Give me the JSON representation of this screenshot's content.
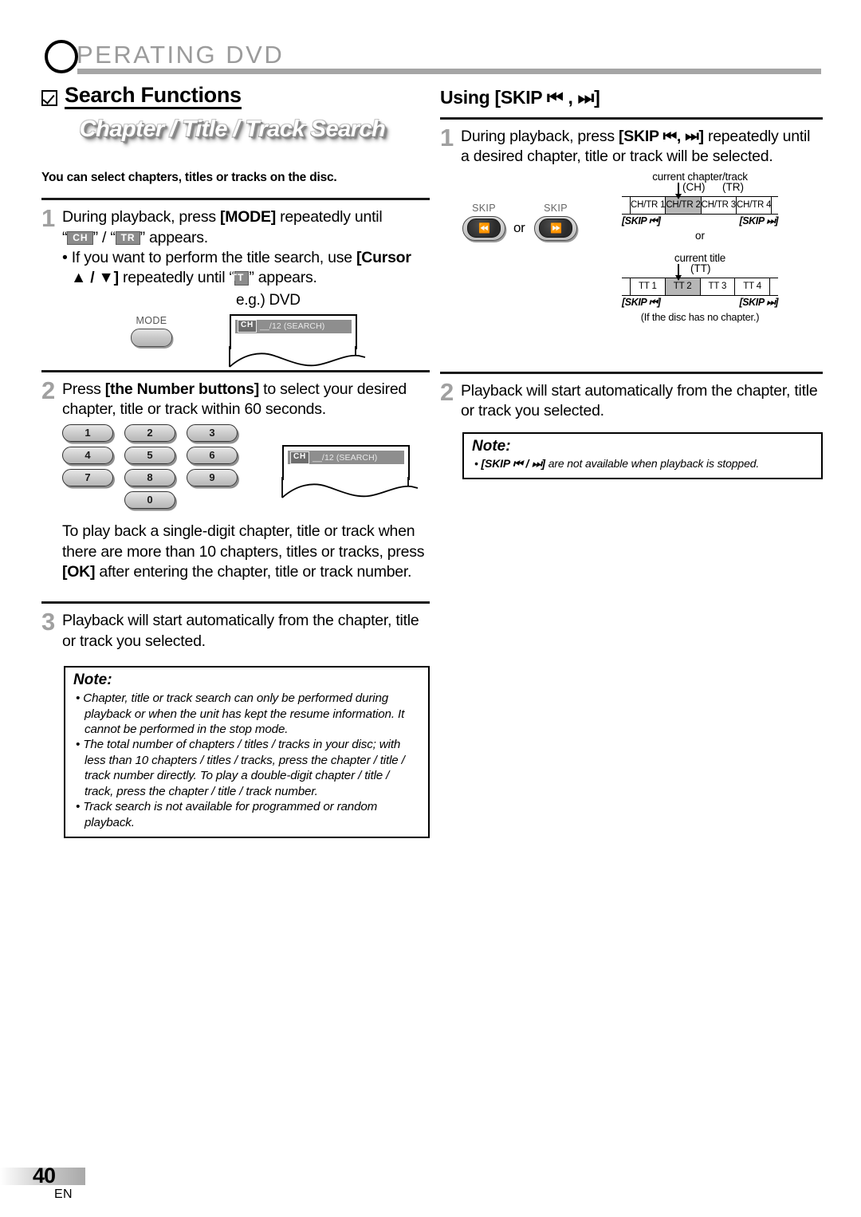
{
  "header": {
    "drop_cap": "O",
    "title": "PERATING  DVD",
    "rule_color": "#a5a5a5"
  },
  "left": {
    "section": {
      "checkbox_icon": "checked-box-icon",
      "title": "Search Functions",
      "banner": "Chapter / Title / Track Search"
    },
    "lead": "You can select chapters, titles or tracks on the disc.",
    "step1": {
      "num": "1",
      "line1_a": "During playback, press ",
      "line1_b": "[MODE]",
      "line1_c": " repeatedly until",
      "line2_open": "“",
      "chip_ch": "CH",
      "line2_mid": "” / “",
      "chip_tr": "TR",
      "line2_end": "” appears.",
      "bullet_a": "• If you want to perform the title search, use",
      "bullet_b": "[Cursor ▲ / ▼]",
      "bullet_c": " repeatedly until “",
      "chip_tt": "TT",
      "bullet_d": "” appears."
    },
    "eg": {
      "label": "e.g.) DVD",
      "mode_label": "MODE",
      "mode_button": "mode-button"
    },
    "osd": {
      "chip": "CH",
      "text": "__/12 (SEARCH)"
    },
    "step2": {
      "num": "2",
      "line_a": "Press ",
      "line_b": "[the Number buttons]",
      "line_c": " to select your desired",
      "line2": "chapter, title or track within 60 seconds.",
      "keys": [
        "1",
        "2",
        "3",
        "4",
        "5",
        "6",
        "7",
        "8",
        "9",
        "0"
      ]
    },
    "para": {
      "a": "To play back a single-digit chapter, title or track when there are more than 10 chapters, titles or tracks, press ",
      "b": "[OK]",
      "c": " after entering the chapter, title or track number."
    },
    "step3": {
      "num": "3",
      "text": "Playback will start automatically from the chapter, title or track you selected."
    },
    "note": {
      "title": "Note:",
      "items": [
        "Chapter, title or track search can only be performed during playback or when the unit has kept the resume information. It cannot be performed in the stop mode.",
        "The total number of chapters / titles / tracks in your disc; with less than 10 chapters / titles / tracks, press the chapter / title / track number directly. To play a double-digit chapter / title / track, press the chapter / title / track number.",
        "Track search is not available for programmed or random playback."
      ]
    }
  },
  "right": {
    "heading": "Using [SKIP ⏮ , ⏭]",
    "step1": {
      "num": "1",
      "line_a": "During playback, press ",
      "line_b": "[SKIP ⏮, ⏭]",
      "line_c": " repeatedly until",
      "line2": "a desired chapter, title or track will be selected."
    },
    "skip_buttons": {
      "label_left": "SKIP",
      "label_right": "SKIP",
      "icon_left": "skip-back-icon",
      "icon_right": "skip-forward-icon",
      "or": "or"
    },
    "timeline_chapter": {
      "caption": "current chapter/track",
      "tag_ch": "(CH)",
      "tag_tr": "(TR)",
      "cells": [
        "CH/TR 1",
        "CH/TR 2",
        "CH/TR 3",
        "CH/TR 4"
      ],
      "highlight_index": 1,
      "foot_left": "[SKIP ⏮]",
      "foot_right": "[SKIP ⏭]"
    },
    "between": "or",
    "timeline_title": {
      "caption": "current title",
      "tag_tt": "(TT)",
      "cells": [
        "TT 1",
        "TT 2",
        "TT 3",
        "TT 4"
      ],
      "highlight_index": 1,
      "foot_left": "[SKIP ⏮]",
      "foot_right": "[SKIP ⏭]",
      "note": "(If the disc has no chapter.)"
    },
    "step2": {
      "num": "2",
      "text": "Playback will start automatically from the chapter, title or track you selected."
    },
    "note": {
      "title": "Note:",
      "item_b": "[SKIP ⏮ / ⏭]",
      "item_rest": " are not available when playback is stopped."
    }
  },
  "footer": {
    "page_number": "40",
    "language": "EN"
  }
}
